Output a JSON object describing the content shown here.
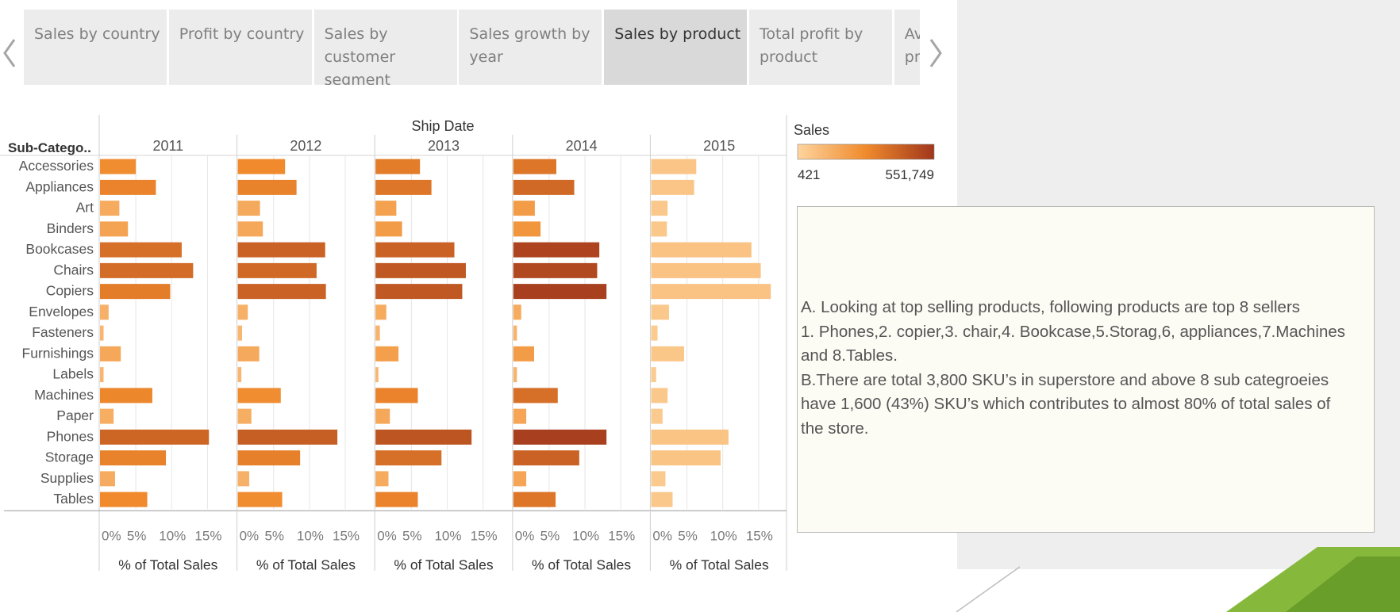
{
  "tabs": [
    {
      "label_lines": [
        "Sales by country"
      ],
      "active": false
    },
    {
      "label_lines": [
        "Profit by country"
      ],
      "active": false
    },
    {
      "label_lines": [
        "Sales by customer",
        "segment"
      ],
      "active": false
    },
    {
      "label_lines": [
        "Sales growth by",
        "year"
      ],
      "active": false
    },
    {
      "label_lines": [
        "Sales by product"
      ],
      "active": true
    },
    {
      "label_lines": [
        "Total profit by",
        "product"
      ],
      "active": false
    },
    {
      "label_lines": [
        "Average",
        "product"
      ],
      "active": false
    }
  ],
  "colors": {
    "scale_low": "#fdd49e",
    "scale_mid": "#f08a2c",
    "scale_high": "#a0371d",
    "gridline": "#e6e6e6",
    "note_bg": "#fcfbf4",
    "panel_bg": "#eeeeee",
    "accent_green": "#86b83b"
  },
  "legend": {
    "title": "Sales",
    "min_label": "421",
    "max_label": "551,749"
  },
  "note": {
    "lines": [
      "A. Looking at top selling products, following products are top 8 sellers",
      "1. Phones,2. copier,3. chair,4. Bookcase,5.Storag,6, appliances,7.Machines",
      "and 8.Tables.",
      "B.There are total 3,800 SKU’s in superstore and above 8 sub categroeies",
      "have 1,600 (43%) SKU’s which contributes to almost 80% of total sales of",
      "the store."
    ]
  },
  "chart_data": {
    "type": "bar",
    "orientation": "horizontal",
    "title": "Ship Date",
    "row_header": "Sub-Catego..",
    "xlabel": "% of Total Sales",
    "x_ticks": [
      "0%",
      "5%",
      "10%",
      "15%"
    ],
    "xlim": [
      0,
      17.5
    ],
    "categories": [
      "Accessories",
      "Appliances",
      "Art",
      "Binders",
      "Bookcases",
      "Chairs",
      "Copiers",
      "Envelopes",
      "Fasteners",
      "Furnishings",
      "Labels",
      "Machines",
      "Paper",
      "Phones",
      "Storage",
      "Supplies",
      "Tables"
    ],
    "panels": [
      {
        "name": "2011",
        "values": [
          5.0,
          7.8,
          2.7,
          3.9,
          11.4,
          13.0,
          9.8,
          1.2,
          0.5,
          2.9,
          0.5,
          7.3,
          1.9,
          15.2,
          9.2,
          2.1,
          6.6
        ],
        "intensity": [
          0.48,
          0.54,
          0.28,
          0.33,
          0.66,
          0.68,
          0.58,
          0.24,
          0.2,
          0.3,
          0.2,
          0.52,
          0.26,
          0.72,
          0.55,
          0.27,
          0.5
        ]
      },
      {
        "name": "2012",
        "values": [
          6.6,
          8.2,
          3.1,
          3.5,
          12.2,
          11.0,
          12.3,
          1.4,
          0.6,
          3.0,
          0.5,
          6.0,
          1.9,
          13.9,
          8.7,
          1.6,
          6.2
        ],
        "intensity": [
          0.5,
          0.55,
          0.29,
          0.3,
          0.74,
          0.7,
          0.74,
          0.24,
          0.2,
          0.29,
          0.2,
          0.48,
          0.26,
          0.76,
          0.56,
          0.24,
          0.48
        ]
      },
      {
        "name": "2013",
        "values": [
          6.2,
          7.8,
          2.9,
          3.7,
          11.0,
          12.6,
          12.1,
          1.5,
          0.6,
          3.2,
          0.4,
          5.9,
          2.0,
          13.4,
          9.2,
          1.8,
          5.9
        ],
        "intensity": [
          0.58,
          0.62,
          0.34,
          0.38,
          0.74,
          0.8,
          0.8,
          0.28,
          0.22,
          0.36,
          0.2,
          0.54,
          0.3,
          0.82,
          0.66,
          0.28,
          0.54
        ]
      },
      {
        "name": "2014",
        "values": [
          6.0,
          8.5,
          3.0,
          3.8,
          12.0,
          11.7,
          13.0,
          1.1,
          0.5,
          2.9,
          0.5,
          6.2,
          1.8,
          13.0,
          9.2,
          1.8,
          5.9
        ],
        "intensity": [
          0.62,
          0.7,
          0.38,
          0.42,
          0.92,
          0.9,
          0.95,
          0.28,
          0.22,
          0.38,
          0.22,
          0.66,
          0.32,
          0.95,
          0.74,
          0.32,
          0.62
        ]
      },
      {
        "name": "2015",
        "values": [
          6.3,
          6.0,
          2.3,
          2.2,
          14.0,
          15.3,
          16.7,
          2.5,
          0.9,
          4.6,
          0.7,
          2.3,
          1.6,
          10.8,
          9.7,
          2.0,
          3.0
        ],
        "intensity": [
          0.1,
          0.1,
          0.08,
          0.08,
          0.12,
          0.12,
          0.12,
          0.08,
          0.06,
          0.09,
          0.06,
          0.08,
          0.07,
          0.11,
          0.11,
          0.07,
          0.08
        ]
      }
    ]
  }
}
